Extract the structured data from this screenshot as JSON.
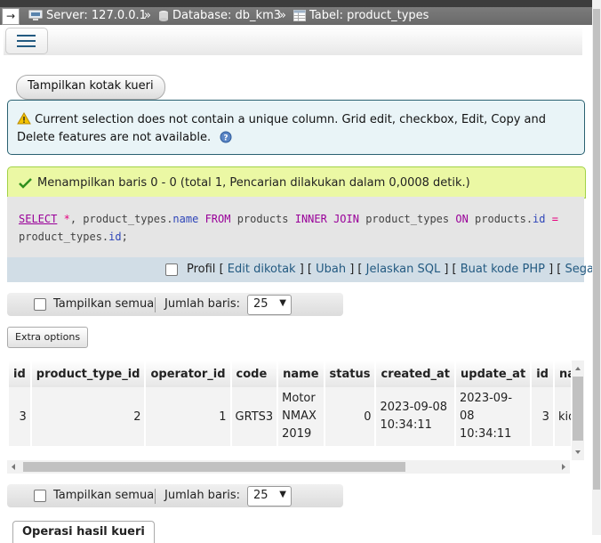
{
  "breadcrumb": {
    "back": "→",
    "server": "Server: 127.0.0.1",
    "database": "Database: db_km3",
    "table": "Tabel: product_types",
    "separator": "»"
  },
  "toolbar": {
    "show_query_box": "Tampilkan kotak kueri"
  },
  "notice": {
    "text": "Current selection does not contain a unique column. Grid edit, checkbox, Edit, Copy and Delete features are not available."
  },
  "result": {
    "message": "Menampilkan baris 0 - 0 (total 1, Pencarian dilakukan dalam 0,0008 detik.)"
  },
  "sql": {
    "parts": [
      "SELECT",
      " ",
      "*",
      ", product_types.",
      "name",
      " ",
      "FROM",
      " products ",
      "INNER JOIN",
      " product_types ",
      "ON",
      " products.",
      "id",
      " ",
      "=",
      "product_types.",
      "id",
      ";"
    ]
  },
  "sql_links": {
    "profil": "Profil",
    "edit_inline": "Edit dikotak",
    "edit": "Ubah",
    "explain": "Jelaskan SQL",
    "php": "Buat kode PHP",
    "refresh": "Segarkan"
  },
  "nav": {
    "show_all": "Tampilkan semua",
    "rows_label": "Jumlah baris:",
    "rows_value": "25"
  },
  "extra_options": "Extra options",
  "table": {
    "headers": [
      "id",
      "product_type_id",
      "operator_id",
      "code",
      "name",
      "status",
      "created_at",
      "update_at",
      "id",
      "nam"
    ],
    "rows": [
      [
        "3",
        "2",
        "1",
        "GRTS3",
        "Motor NMAX 2019",
        "0",
        "2023-09-08 10:34:11",
        "2023-09-08 10:34:11",
        "3",
        "kids"
      ]
    ]
  },
  "operations_tab": "Operasi hasil kueri"
}
